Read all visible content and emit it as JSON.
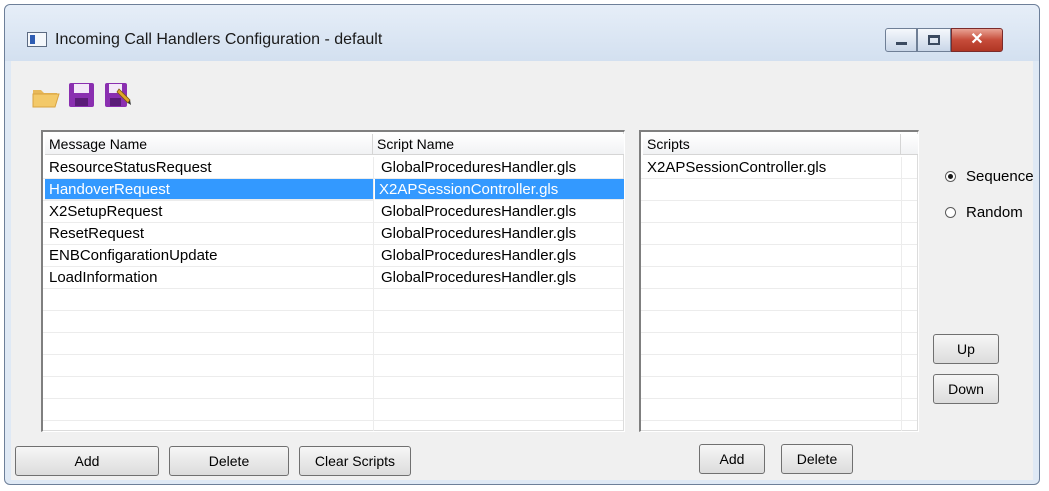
{
  "window": {
    "title": "Incoming Call Handlers Configuration - default",
    "controls": {
      "minimize": "minimize",
      "maximize": "maximize",
      "close": "✕"
    }
  },
  "toolbar": {
    "icons": [
      "open-folder-icon",
      "save-icon",
      "save-as-icon"
    ]
  },
  "handlers_table": {
    "columns": [
      "Message Name",
      "Script Name"
    ],
    "rows": [
      {
        "message": "ResourceStatusRequest",
        "script": "GlobalProceduresHandler.gls"
      },
      {
        "message": "HandoverRequest",
        "script": "X2APSessionController.gls"
      },
      {
        "message": "X2SetupRequest",
        "script": "GlobalProceduresHandler.gls"
      },
      {
        "message": "ResetRequest",
        "script": "GlobalProceduresHandler.gls"
      },
      {
        "message": "ENBConfigarationUpdate",
        "script": "GlobalProceduresHandler.gls"
      },
      {
        "message": "LoadInformation",
        "script": "GlobalProceduresHandler.gls"
      }
    ],
    "selected_index": 1
  },
  "scripts_table": {
    "column": "Scripts",
    "rows": [
      "X2APSessionController.gls"
    ]
  },
  "order_options": {
    "sequence": "Sequence",
    "random": "Random",
    "selected": "Sequence"
  },
  "buttons": {
    "up": "Up",
    "down": "Down",
    "add": "Add",
    "delete": "Delete",
    "clear_scripts": "Clear Scripts",
    "scripts_add": "Add",
    "scripts_delete": "Delete"
  },
  "colors": {
    "selection": "#3399ff",
    "frame": "#dfe9f5"
  }
}
